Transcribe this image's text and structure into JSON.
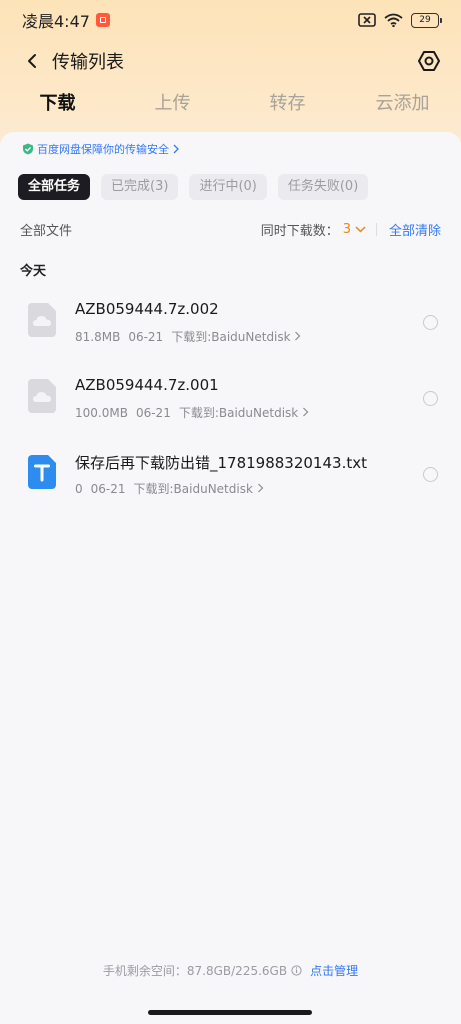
{
  "status_bar": {
    "time": "凌晨4:47",
    "battery": "29",
    "icons": [
      "notification-icon",
      "sim-off-icon",
      "wifi-icon",
      "battery-icon"
    ]
  },
  "header": {
    "title": "传输列表",
    "icons": [
      "back-icon",
      "settings-icon"
    ]
  },
  "tabs": [
    {
      "label": "下载",
      "active": true
    },
    {
      "label": "上传",
      "active": false
    },
    {
      "label": "转存",
      "active": false
    },
    {
      "label": "云添加",
      "active": false
    }
  ],
  "security_note": "百度网盘保障你的传输安全",
  "filters": [
    {
      "label": "全部任务",
      "active": true
    },
    {
      "label": "已完成(3)",
      "active": false
    },
    {
      "label": "进行中(0)",
      "active": false
    },
    {
      "label": "任务失败(0)",
      "active": false
    }
  ],
  "list_header": {
    "left": "全部文件",
    "concurrent_label": "同时下载数：",
    "concurrent_value": "3",
    "clear_all": "全部清除"
  },
  "section_title": "今天",
  "files": [
    {
      "name": "AZB059444.7z.002",
      "size": "81.8MB",
      "date": "06-21",
      "dest": "下载到:BaiduNetdisk",
      "icon": "cloud-file-icon"
    },
    {
      "name": "AZB059444.7z.001",
      "size": "100.0MB",
      "date": "06-21",
      "dest": "下载到:BaiduNetdisk",
      "icon": "cloud-file-icon"
    },
    {
      "name": "保存后再下载防出错_1781988320143.txt",
      "size": "0",
      "date": "06-21",
      "dest": "下载到:BaiduNetdisk",
      "icon": "text-file-icon"
    }
  ],
  "footer": {
    "storage": "手机剩余空间：87.8GB/225.6GB",
    "manage": "点击管理"
  },
  "colors": {
    "accent_blue": "#3478f6",
    "accent_orange": "#e7861f",
    "text_file_blue": "#2d8cf0"
  }
}
